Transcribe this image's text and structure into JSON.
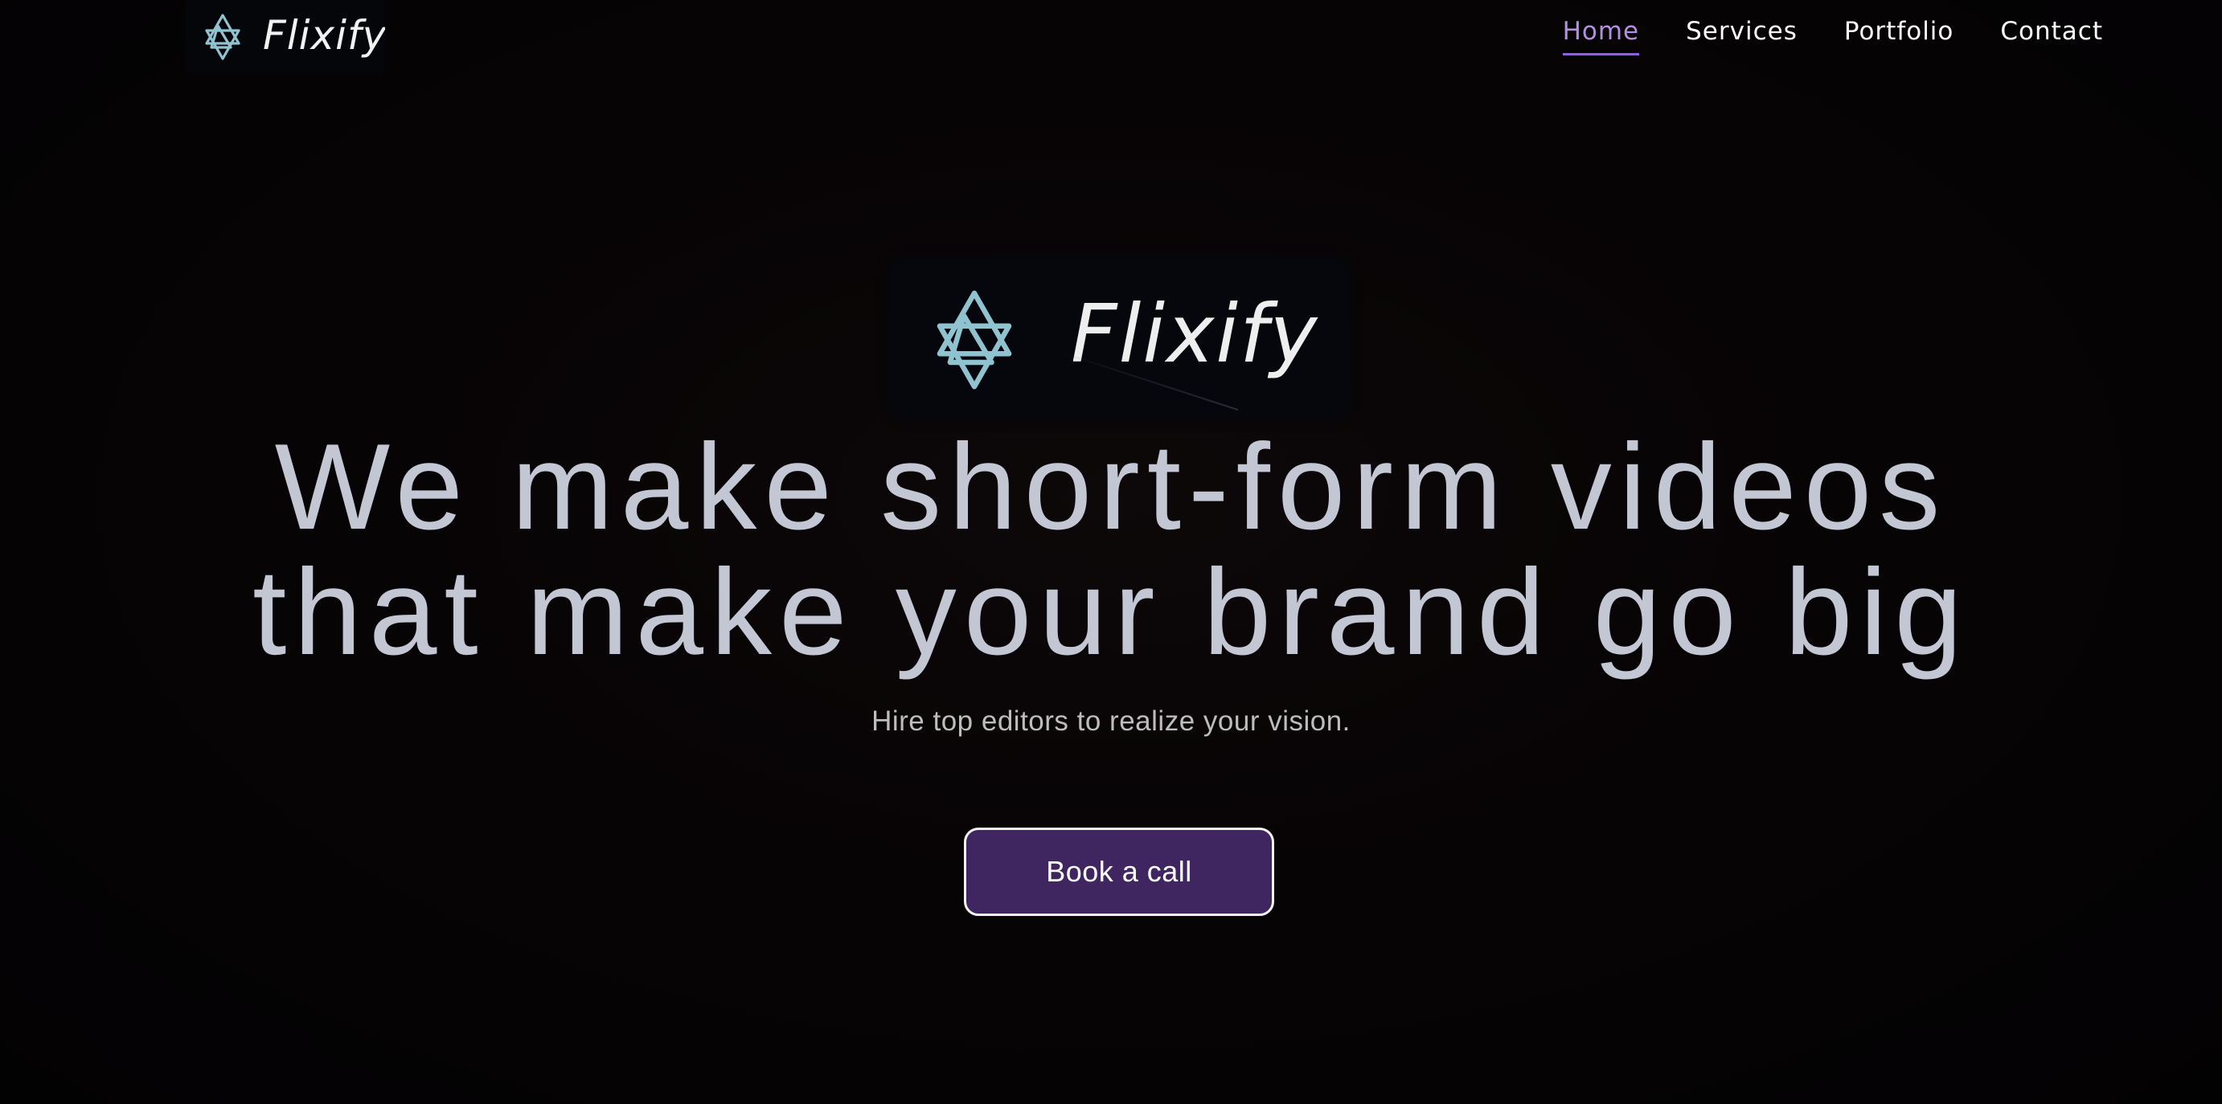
{
  "brand": {
    "name": "Flixify",
    "logo_icon": "interlocked-triangles-icon",
    "logo_color": "#8fc3cf",
    "wordmark_color": "#f2f2f2"
  },
  "nav": {
    "items": [
      {
        "label": "Home",
        "active": true
      },
      {
        "label": "Services",
        "active": false
      },
      {
        "label": "Portfolio",
        "active": false
      },
      {
        "label": "Contact",
        "active": false
      }
    ],
    "active_color": "#b38fe0"
  },
  "hero": {
    "headline_line1": "We make short-form videos",
    "headline_line2": "that make your brand go big",
    "subheadline": "Hire top editors to realize your vision.",
    "cta_label": "Book a call",
    "cta_color": "#3f2660"
  }
}
